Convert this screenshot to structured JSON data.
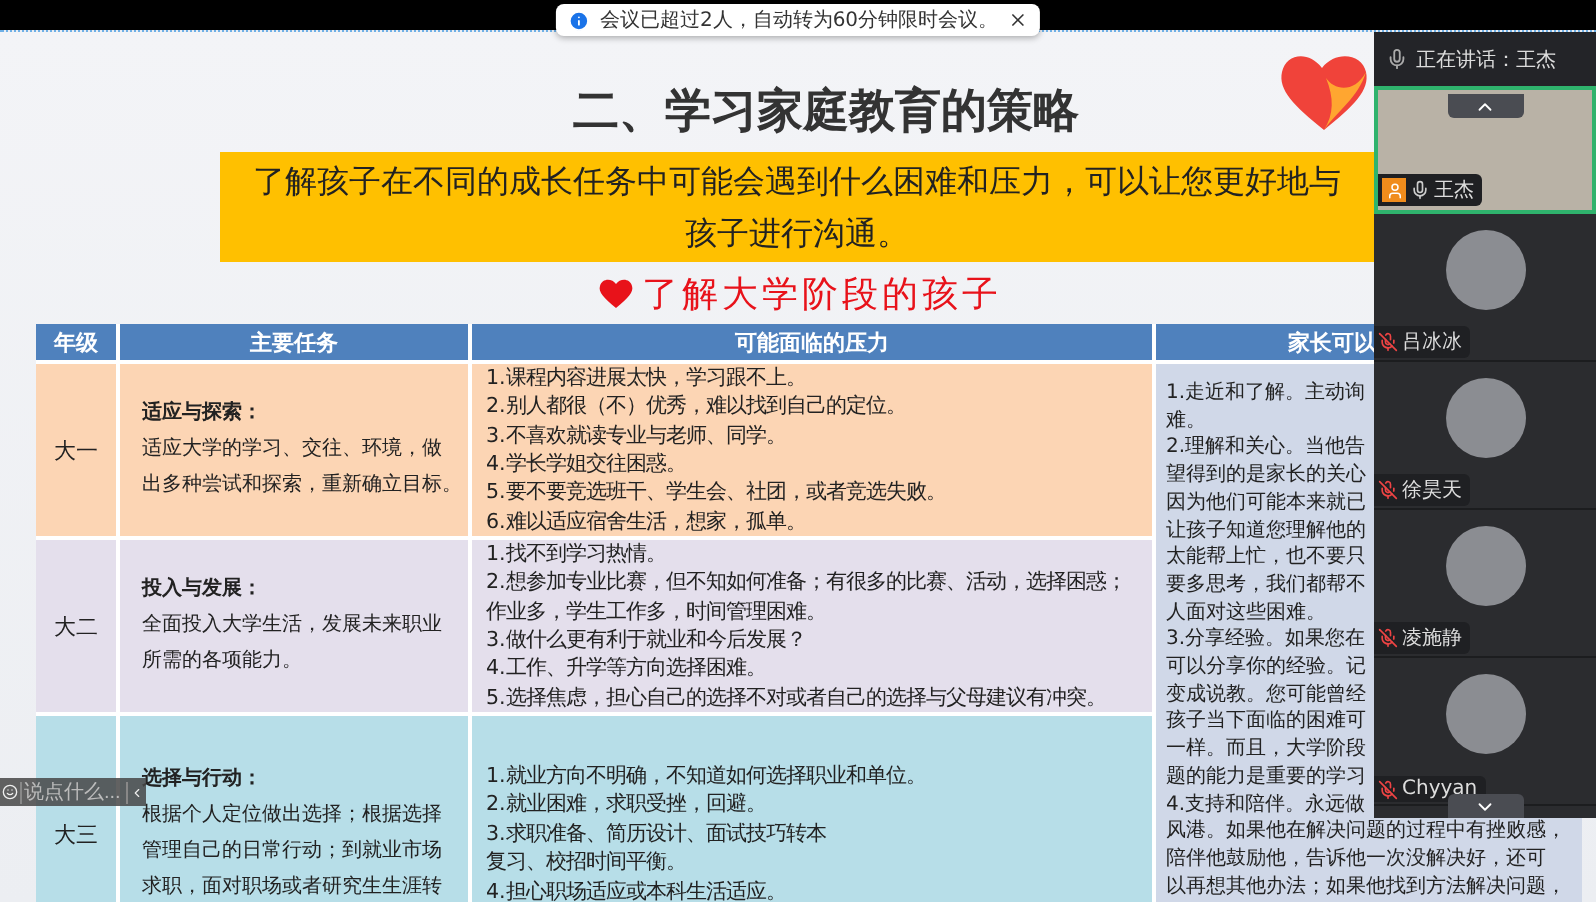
{
  "notification": {
    "text": "会议已超过2人，自动转为60分钟限时会议。"
  },
  "slide": {
    "title": "二、学习家庭教育的策略",
    "banner_lines": [
      "了解孩子在不同的成长任务中可能会遇到什么困难和压力，可以让您更好地与",
      "孩子进行沟通。"
    ],
    "subtitle": "了解大学阶段的孩子"
  },
  "table": {
    "columns": [
      "年级",
      "主要任务",
      "可能面临的压力",
      "家长可以"
    ],
    "rows": [
      {
        "grade": "大一",
        "color": "#fcd5b4",
        "task_title": "适应与探索：",
        "task_lines": [
          "适应大学的学习、交往、环境，做",
          "出多种尝试和探索，重新确立目标。"
        ],
        "pressures": [
          [
            "1.课程内容进展太快，学习跟不上。"
          ],
          [
            "2.别人都很（不）优秀，难以找到自己的定位。"
          ],
          [
            "3.不喜欢就读专业与老师、同学。"
          ],
          [
            "4.学长学姐交往困惑。"
          ],
          [
            "5.要不要竞选班干、学生会、社团，或者竞选失败。"
          ],
          [
            "6.难以适应宿舍生活，想家，孤单。"
          ]
        ]
      },
      {
        "grade": "大二",
        "color": "#e4dfec",
        "task_title": "投入与发展：",
        "task_lines": [
          "全面投入大学生活，发展未来职业",
          "所需的各项能力。"
        ],
        "pressures": [
          [
            "1.找不到学习热情。"
          ],
          [
            "2.想参加专业比赛，但不知如何准备；有很多的比赛、活动，选择困惑；",
            "作业多，学生工作多，时间管理困难。"
          ],
          [
            "3.做什么更有利于就业和今后发展？"
          ],
          [
            "4.工作、升学等方向选择困难。"
          ],
          [
            "5.选择焦虑，担心自己的选择不对或者自己的选择与父母建议有冲突。"
          ]
        ]
      },
      {
        "grade": "大三",
        "color": "#b7dee8",
        "task_title": "选择与行动：",
        "task_lines": [
          "根据个人定位做出选择；根据选择",
          "管理自己的日常行动；到就业市场",
          "求职，面对职场或者研究生生涯转"
        ],
        "pressures": [
          [
            "1.就业方向不明确，不知道如何选择职业和单位。"
          ],
          [
            "2.就业困难，求职受挫，回避。"
          ],
          [
            "3.求职准备、简历设计、面试技巧转本",
            "复习、校招时间平衡。"
          ],
          [
            "4.担心职场适应或本科生活适应。"
          ]
        ]
      }
    ],
    "advice_lines": [
      "1.走近和了解。主动询",
      "难。",
      "2.理解和关心。当他告",
      "望得到的是家长的关心",
      "因为他们可能本来就已",
      "让孩子知道您理解他的",
      "太能帮上忙，也不要只",
      "要多思考，我们都帮不",
      "人面对这些困难。",
      "3.分享经验。如果您在",
      "可以分享你的经验。记",
      "变成说教。您可能曾经",
      "孩子当下面临的困难可",
      "一样。而且，大学阶段",
      "题的能力是重要的学习",
      "4.支持和陪伴。永远做",
      "风港。如果他在解决问题的过程中有挫败感，",
      "陪伴他鼓励他，告诉他一次没解决好，还可",
      "以再想其他办法；如果他找到方法解决问题，"
    ]
  },
  "chat_input": {
    "placeholder": "说点什么..."
  },
  "meeting_panel": {
    "speaking": "正在讲话：王杰",
    "participants": [
      {
        "name": "王杰",
        "kind": "video",
        "host": true,
        "muted": false,
        "speaking": true
      },
      {
        "name": "吕冰冰",
        "kind": "avatar",
        "host": false,
        "muted": true,
        "speaking": false
      },
      {
        "name": "徐昊天",
        "kind": "avatar",
        "host": false,
        "muted": true,
        "speaking": false
      },
      {
        "name": "凌施静",
        "kind": "avatar",
        "host": false,
        "muted": true,
        "speaking": false
      },
      {
        "name": "Chyyan",
        "kind": "avatar",
        "host": false,
        "muted": true,
        "speaking": false
      }
    ]
  }
}
